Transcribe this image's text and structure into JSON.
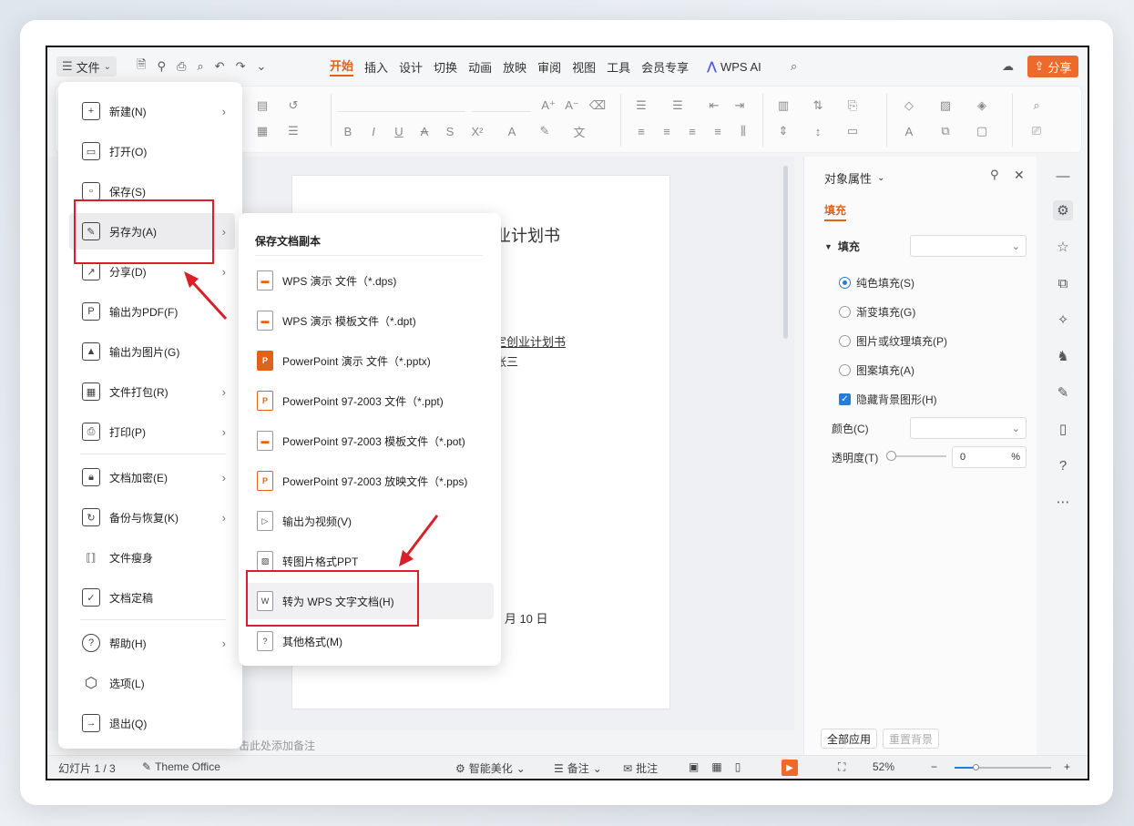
{
  "window": {
    "file_menu_label": "文件",
    "tabs": [
      "开始",
      "插入",
      "设计",
      "切换",
      "动画",
      "放映",
      "审阅",
      "视图",
      "工具",
      "会员专享"
    ],
    "wps_ai": "WPS AI",
    "share": "分享"
  },
  "slide": {
    "title_fragment": "业计划书",
    "line1": "定创业计划书",
    "line2": "张三",
    "date_fragment": "1 月 10 日"
  },
  "notes_placeholder": "击此处添加备注",
  "file_menu": {
    "items": [
      {
        "label": "新建(N)",
        "icon": "new-file-icon",
        "arrow": true
      },
      {
        "label": "打开(O)",
        "icon": "folder-icon",
        "arrow": false
      },
      {
        "label": "保存(S)",
        "icon": "save-icon",
        "arrow": false
      },
      {
        "label": "另存为(A)",
        "icon": "save-as-icon",
        "arrow": true
      },
      {
        "label": "分享(D)",
        "icon": "share-icon",
        "arrow": true
      },
      {
        "label": "输出为PDF(F)",
        "icon": "pdf-icon",
        "arrow": false
      },
      {
        "label": "输出为图片(G)",
        "icon": "image-icon",
        "arrow": false
      },
      {
        "label": "文件打包(R)",
        "icon": "package-icon",
        "arrow": true
      },
      {
        "label": "打印(P)",
        "icon": "print-icon",
        "arrow": true
      },
      {
        "label": "文档加密(E)",
        "icon": "lock-doc-icon",
        "arrow": true
      },
      {
        "label": "备份与恢复(K)",
        "icon": "backup-icon",
        "arrow": true
      },
      {
        "label": "文件瘦身",
        "icon": "slim-icon",
        "arrow": false
      },
      {
        "label": "文档定稿",
        "icon": "finalize-icon",
        "arrow": false
      },
      {
        "label": "帮助(H)",
        "icon": "help-icon",
        "arrow": true
      },
      {
        "label": "选项(L)",
        "icon": "options-icon",
        "arrow": false
      },
      {
        "label": "退出(Q)",
        "icon": "exit-icon",
        "arrow": false
      }
    ]
  },
  "save_as_submenu": {
    "heading": "保存文档副本",
    "items": [
      {
        "label": "WPS 演示 文件（*.dps)",
        "icon": "dps-file-icon"
      },
      {
        "label": "WPS 演示 模板文件（*.dpt)",
        "icon": "dpt-file-icon"
      },
      {
        "label": "PowerPoint 演示 文件（*.pptx)",
        "icon": "pptx-file-icon"
      },
      {
        "label": "PowerPoint 97-2003 文件（*.ppt)",
        "icon": "ppt-file-icon"
      },
      {
        "label": "PowerPoint 97-2003 模板文件（*.pot)",
        "icon": "pot-file-icon"
      },
      {
        "label": "PowerPoint 97-2003 放映文件（*.pps)",
        "icon": "pps-file-icon"
      },
      {
        "label": "输出为视频(V)",
        "icon": "video-icon"
      },
      {
        "label": "转图片格式PPT",
        "icon": "image-ppt-icon"
      },
      {
        "label": "转为 WPS 文字文档(H)",
        "icon": "wps-doc-icon"
      },
      {
        "label": "其他格式(M)",
        "icon": "other-format-icon"
      }
    ]
  },
  "object_pane": {
    "title": "对象属性",
    "tab": "填充",
    "section": "填充",
    "options": [
      "纯色填充(S)",
      "渐变填充(G)",
      "图片或纹理填充(P)",
      "图案填充(A)"
    ],
    "hide_bg": "隐藏背景图形(H)",
    "color_label": "颜色(C)",
    "transparency_label": "透明度(T)",
    "transparency_value": "0",
    "percent": "%",
    "apply_all": "全部应用",
    "reset_bg": "重置背景"
  },
  "statusbar": {
    "slide_count": "幻灯片 1 / 3",
    "theme": "Theme Office",
    "smart_beautify": "智能美化",
    "notes": "备注",
    "comments": "批注",
    "zoom": "52%"
  },
  "colors": {
    "accent": "#e0631a",
    "highlight_box": "#d9202a",
    "share_bg": "#ee6a2a"
  }
}
